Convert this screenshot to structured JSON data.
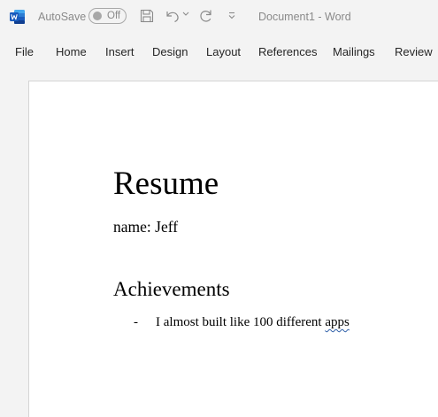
{
  "titlebar": {
    "autosave_label": "AutoSave",
    "autosave_state": "Off",
    "document_title": "Document1  -  Word"
  },
  "ribbon": {
    "tabs": [
      "File",
      "Home",
      "Insert",
      "Design",
      "Layout",
      "References",
      "Mailings",
      "Review"
    ]
  },
  "document": {
    "heading": "Resume",
    "name_line": "name: Jeff",
    "subheading": "Achievements",
    "bullet_marker": "-",
    "bullet_text_main": "I almost built like 100 different ",
    "bullet_text_flagged": "apps"
  },
  "icons": {
    "app": "word-logo-icon",
    "save": "save-icon",
    "undo": "undo-icon",
    "redo": "redo-icon",
    "customize": "customize-toolbar-icon"
  },
  "colors": {
    "word_blue": "#185abd",
    "spellcheck": "#2e5fa8"
  }
}
